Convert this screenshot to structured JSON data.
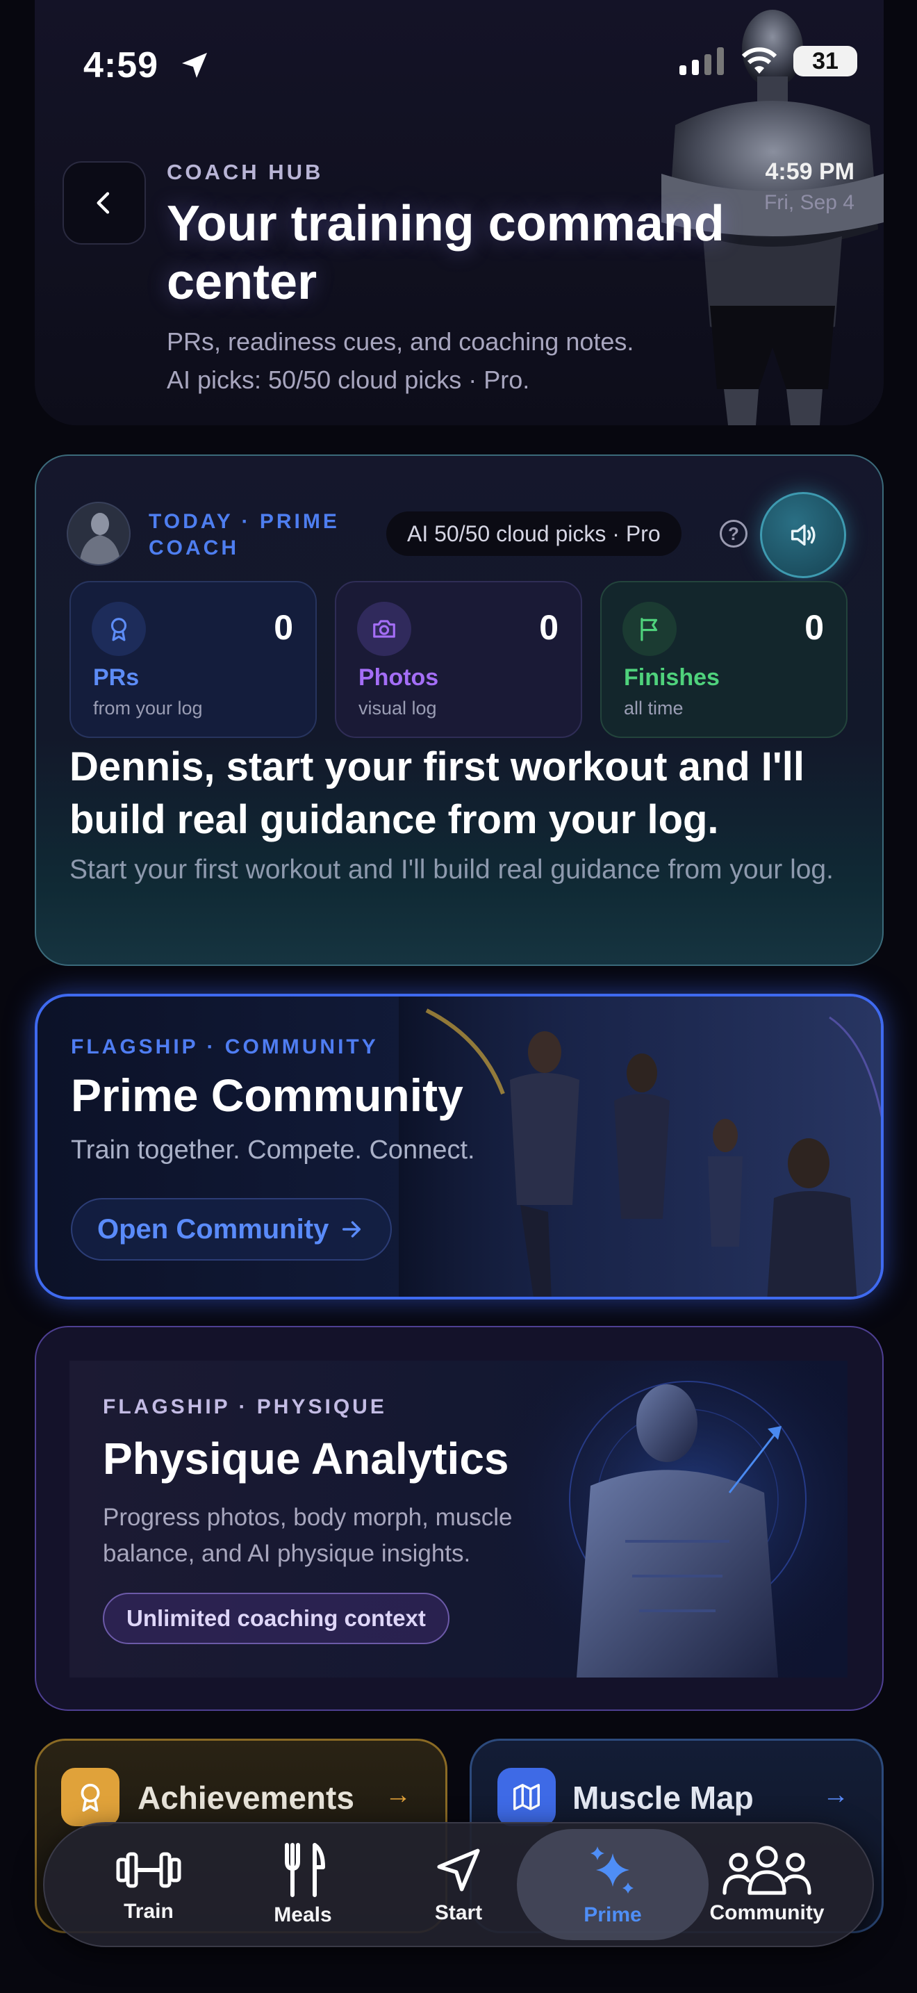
{
  "status_bar": {
    "time": "4:59",
    "battery": "31"
  },
  "header": {
    "eyebrow": "COACH HUB",
    "title": "Your training command center",
    "subtitle_line1": "PRs, readiness cues, and coaching notes.",
    "subtitle_line2": "AI picks: 50/50 cloud picks · Pro.",
    "clock_time": "4:59 PM",
    "clock_date": "Fri, Sep 4"
  },
  "today": {
    "eyebrow": "TODAY · PRIME COACH",
    "ai_pill": "AI 50/50 cloud picks · Pro",
    "stats": [
      {
        "value": "0",
        "label": "PRs",
        "sub": "from your log",
        "icon": "award-icon"
      },
      {
        "value": "0",
        "label": "Photos",
        "sub": "visual log",
        "icon": "camera-icon"
      },
      {
        "value": "0",
        "label": "Finishes",
        "sub": "all time",
        "icon": "flag-icon"
      }
    ],
    "headline": "Dennis, start your first workout and I'll build real guidance from your log.",
    "subtext": "Start your first workout and I'll build real guidance from your log."
  },
  "community": {
    "eyebrow": "FLAGSHIP · COMMUNITY",
    "title": "Prime Community",
    "subtitle": "Train together. Compete. Connect.",
    "button": "Open Community"
  },
  "physique": {
    "eyebrow": "FLAGSHIP · PHYSIQUE",
    "title": "Physique Analytics",
    "subtitle": "Progress photos, body morph, muscle balance, and AI physique insights.",
    "pill": "Unlimited coaching context"
  },
  "tiles": {
    "achievements": "Achievements",
    "muscle_map": "Muscle Map",
    "arrow": "→"
  },
  "tabbar": {
    "items": [
      {
        "label": "Train",
        "icon": "dumbbell-icon"
      },
      {
        "label": "Meals",
        "icon": "utensils-icon"
      },
      {
        "label": "Start",
        "icon": "navigation-icon"
      },
      {
        "label": "Prime",
        "icon": "sparkles-icon",
        "active": true
      },
      {
        "label": "Community",
        "icon": "users-icon"
      }
    ]
  },
  "colors": {
    "accent_blue": "#4f7df2",
    "prs": "#5d8cf6",
    "photos": "#a46ef6",
    "finishes": "#4fd27c",
    "achievements": "#e0a23a"
  }
}
